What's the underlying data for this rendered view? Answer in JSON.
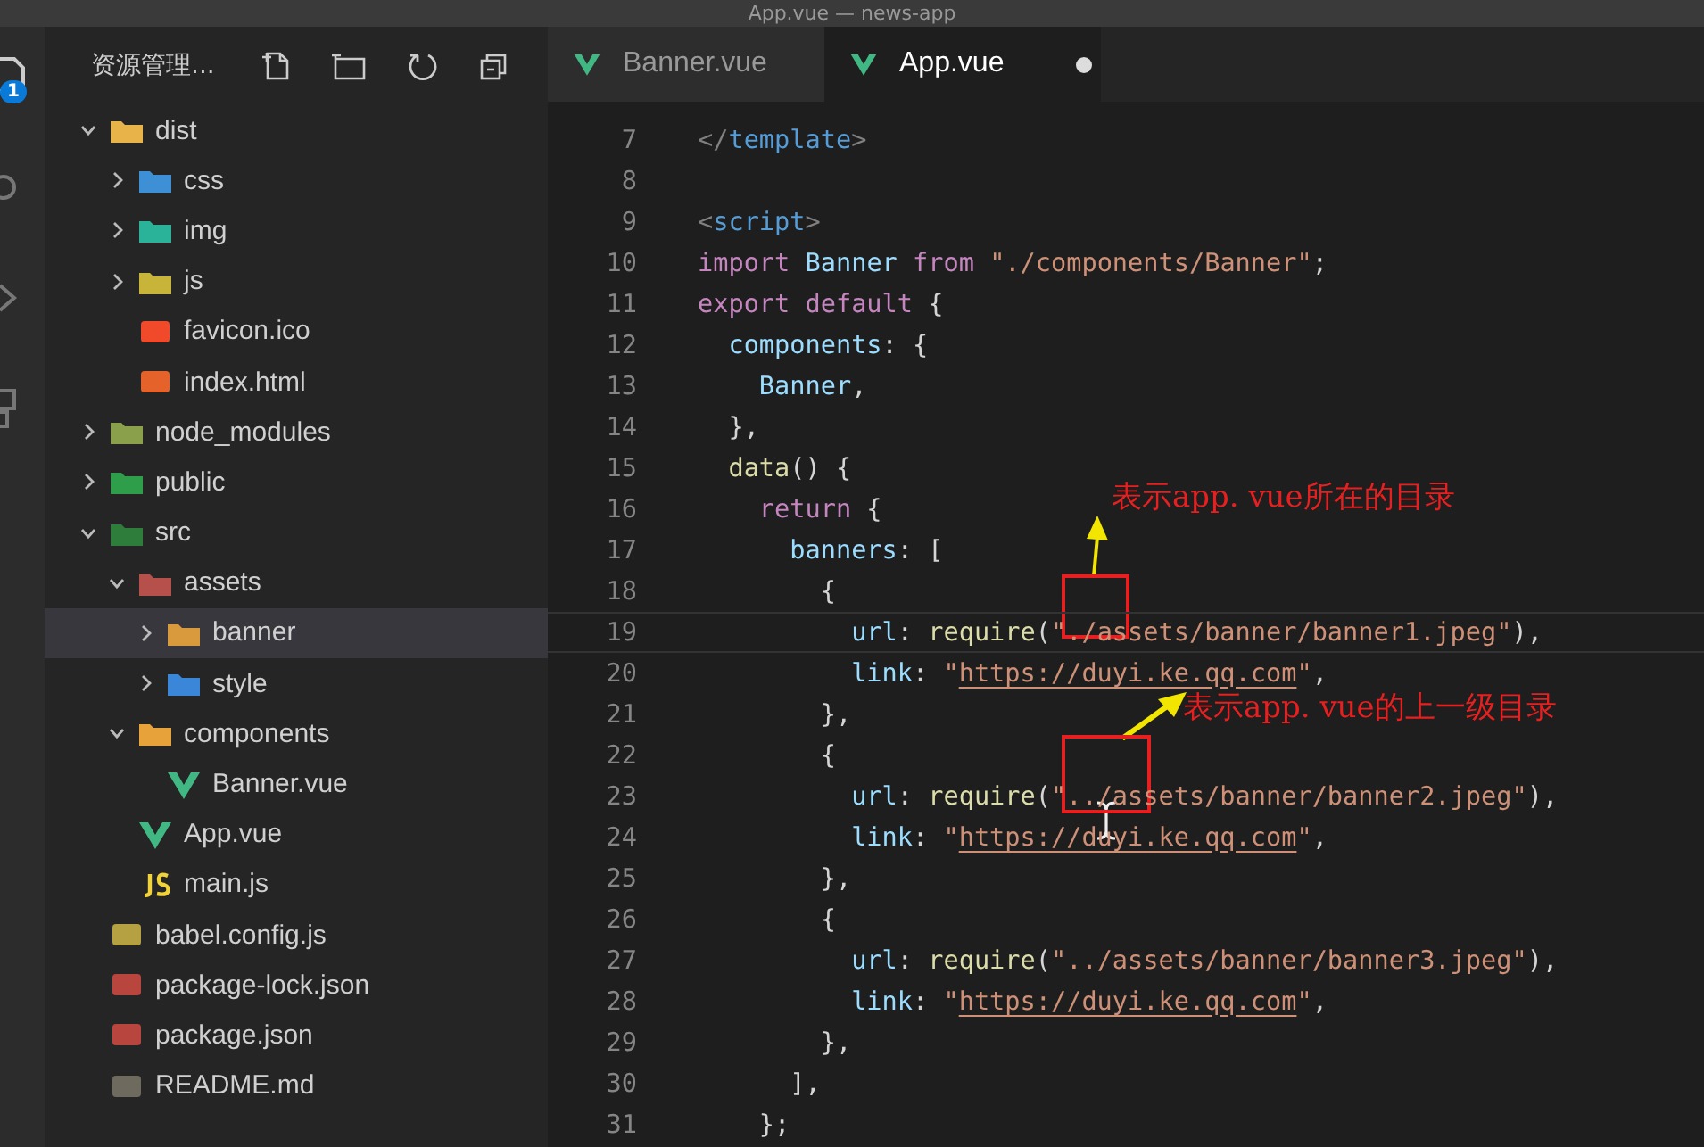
{
  "window": {
    "title": "App.vue — news-app"
  },
  "activity_bar": {
    "badge": "1"
  },
  "sidebar": {
    "title": "资源管理...",
    "tree": [
      {
        "name": "dist",
        "kind": "folder",
        "color": "#e8b44a",
        "expanded": true,
        "selected": false,
        "children": [
          {
            "name": "css",
            "kind": "folder",
            "color": "#3d8fd6",
            "expanded": false,
            "selected": false
          },
          {
            "name": "img",
            "kind": "folder",
            "color": "#2bb39a",
            "expanded": false,
            "selected": false
          },
          {
            "name": "js",
            "kind": "folder",
            "color": "#c9b43a",
            "expanded": false,
            "selected": false
          },
          {
            "name": "favicon.ico",
            "kind": "file",
            "color": "#f04a2a",
            "selected": false
          },
          {
            "name": "index.html",
            "kind": "file",
            "color": "#e5622b",
            "selected": false
          }
        ]
      },
      {
        "name": "node_modules",
        "kind": "folder",
        "color": "#8aa04a",
        "expanded": false,
        "selected": false
      },
      {
        "name": "public",
        "kind": "folder",
        "color": "#2e9e4a",
        "expanded": false,
        "selected": false
      },
      {
        "name": "src",
        "kind": "folder",
        "color": "#2f7d3a",
        "expanded": true,
        "selected": false,
        "children": [
          {
            "name": "assets",
            "kind": "folder",
            "color": "#b5504a",
            "expanded": true,
            "selected": false,
            "children": [
              {
                "name": "banner",
                "kind": "folder",
                "color": "#d89a3c",
                "expanded": false,
                "selected": true
              },
              {
                "name": "style",
                "kind": "folder",
                "color": "#3a86d8",
                "expanded": false,
                "selected": false
              }
            ]
          },
          {
            "name": "components",
            "kind": "folder",
            "color": "#e8a23a",
            "expanded": true,
            "selected": false,
            "children": [
              {
                "name": "Banner.vue",
                "kind": "vue",
                "color": "#41b883",
                "selected": false
              }
            ]
          },
          {
            "name": "App.vue",
            "kind": "vue",
            "color": "#41b883",
            "selected": false
          },
          {
            "name": "main.js",
            "kind": "js",
            "color": "#f1d23a",
            "selected": false
          }
        ]
      },
      {
        "name": "babel.config.js",
        "kind": "file",
        "color": "#b5a042",
        "selected": false
      },
      {
        "name": "package-lock.json",
        "kind": "file",
        "color": "#b8453e",
        "selected": false
      },
      {
        "name": "package.json",
        "kind": "file",
        "color": "#b8453e",
        "selected": false
      },
      {
        "name": "README.md",
        "kind": "file",
        "color": "#6e6a5e",
        "selected": false
      }
    ]
  },
  "tabs": [
    {
      "label": "Banner.vue",
      "selected": false,
      "modified": false
    },
    {
      "label": "App.vue",
      "selected": true,
      "modified": true
    }
  ],
  "editor": {
    "lines": [
      {
        "number": "7",
        "current": false,
        "tokens": [
          {
            "t": "</",
            "kind": "punct"
          },
          {
            "t": "template",
            "kind": "tag"
          },
          {
            "t": ">",
            "kind": "punct"
          }
        ]
      },
      {
        "number": "8",
        "current": false
      },
      {
        "number": "9",
        "current": false,
        "tokens": [
          {
            "t": "<",
            "kind": "punct"
          },
          {
            "t": "script",
            "kind": "tag"
          },
          {
            "t": ">",
            "kind": "punct"
          }
        ]
      },
      {
        "number": "10",
        "current": false,
        "tokens": [
          {
            "t": "import",
            "kind": "keyword"
          },
          {
            "t": " Banner ",
            "kind": "ident"
          },
          {
            "t": "from",
            "kind": "keyword"
          },
          {
            "t": " \"./components/Banner\"",
            "kind": "string"
          },
          {
            "t": ";",
            "kind": "plain"
          }
        ]
      },
      {
        "number": "11",
        "current": false,
        "tokens": [
          {
            "t": "export default",
            "kind": "keyword"
          },
          {
            "t": " {",
            "kind": "plain"
          }
        ]
      },
      {
        "number": "12",
        "current": false,
        "tokens": [
          {
            "t": "  components",
            "kind": "ident"
          },
          {
            "t": ": {",
            "kind": "plain"
          }
        ]
      },
      {
        "number": "13",
        "current": false,
        "tokens": [
          {
            "t": "    Banner",
            "kind": "ident"
          },
          {
            "t": ",",
            "kind": "plain"
          }
        ]
      },
      {
        "number": "14",
        "current": false,
        "tokens": [
          {
            "t": "  },",
            "kind": "plain"
          }
        ]
      },
      {
        "number": "15",
        "current": false,
        "tokens": [
          {
            "t": "  data",
            "kind": "func"
          },
          {
            "t": "() {",
            "kind": "plain"
          }
        ]
      },
      {
        "number": "16",
        "current": false,
        "tokens": [
          {
            "t": "    return",
            "kind": "keyword"
          },
          {
            "t": " {",
            "kind": "plain"
          }
        ]
      },
      {
        "number": "17",
        "current": false,
        "tokens": [
          {
            "t": "      banners",
            "kind": "ident"
          },
          {
            "t": ": [",
            "kind": "plain"
          }
        ]
      },
      {
        "number": "18",
        "current": false,
        "tokens": [
          {
            "t": "        {",
            "kind": "plain"
          }
        ]
      },
      {
        "number": "19",
        "current": true,
        "tokens": [
          {
            "t": "          url",
            "kind": "ident"
          },
          {
            "t": ": ",
            "kind": "plain"
          },
          {
            "t": "require",
            "kind": "func"
          },
          {
            "t": "(",
            "kind": "plain"
          },
          {
            "t": "\"./assets/banner/banner1.jpeg\"",
            "kind": "string"
          },
          {
            "t": "),",
            "kind": "plain"
          }
        ]
      },
      {
        "number": "20",
        "current": false,
        "tokens": [
          {
            "t": "          link",
            "kind": "ident"
          },
          {
            "t": ": ",
            "kind": "plain"
          },
          {
            "t": "\"",
            "kind": "string"
          },
          {
            "t": "https://duyi.ke.qq.com",
            "kind": "link"
          },
          {
            "t": "\"",
            "kind": "string"
          },
          {
            "t": ",",
            "kind": "plain"
          }
        ]
      },
      {
        "number": "21",
        "current": false,
        "tokens": [
          {
            "t": "        },",
            "kind": "plain"
          }
        ]
      },
      {
        "number": "22",
        "current": false,
        "tokens": [
          {
            "t": "        {",
            "kind": "plain"
          }
        ]
      },
      {
        "number": "23",
        "current": false,
        "tokens": [
          {
            "t": "          url",
            "kind": "ident"
          },
          {
            "t": ": ",
            "kind": "plain"
          },
          {
            "t": "require",
            "kind": "func"
          },
          {
            "t": "(",
            "kind": "plain"
          },
          {
            "t": "\"../assets/banner/banner2.jpeg\"",
            "kind": "string"
          },
          {
            "t": "),",
            "kind": "plain"
          }
        ]
      },
      {
        "number": "24",
        "current": false,
        "tokens": [
          {
            "t": "          link",
            "kind": "ident"
          },
          {
            "t": ": ",
            "kind": "plain"
          },
          {
            "t": "\"",
            "kind": "string"
          },
          {
            "t": "https://duyi.ke.qq.com",
            "kind": "link"
          },
          {
            "t": "\"",
            "kind": "string"
          },
          {
            "t": ",",
            "kind": "plain"
          }
        ]
      },
      {
        "number": "25",
        "current": false,
        "tokens": [
          {
            "t": "        },",
            "kind": "plain"
          }
        ]
      },
      {
        "number": "26",
        "current": false,
        "tokens": [
          {
            "t": "        {",
            "kind": "plain"
          }
        ]
      },
      {
        "number": "27",
        "current": false,
        "tokens": [
          {
            "t": "          url",
            "kind": "ident"
          },
          {
            "t": ": ",
            "kind": "plain"
          },
          {
            "t": "require",
            "kind": "func"
          },
          {
            "t": "(",
            "kind": "plain"
          },
          {
            "t": "\"../assets/banner/banner3.jpeg\"",
            "kind": "string"
          },
          {
            "t": "),",
            "kind": "plain"
          }
        ]
      },
      {
        "number": "28",
        "current": false,
        "tokens": [
          {
            "t": "          link",
            "kind": "ident"
          },
          {
            "t": ": ",
            "kind": "plain"
          },
          {
            "t": "\"",
            "kind": "string"
          },
          {
            "t": "https://duyi.ke.qq.com",
            "kind": "link"
          },
          {
            "t": "\"",
            "kind": "string"
          },
          {
            "t": ",",
            "kind": "plain"
          }
        ]
      },
      {
        "number": "29",
        "current": false,
        "tokens": [
          {
            "t": "        },",
            "kind": "plain"
          }
        ]
      },
      {
        "number": "30",
        "current": false,
        "tokens": [
          {
            "t": "      ],",
            "kind": "plain"
          }
        ]
      },
      {
        "number": "31",
        "current": false,
        "tokens": [
          {
            "t": "    };",
            "kind": "plain"
          }
        ]
      }
    ]
  },
  "annotations": [
    {
      "text": "表示app. vue所在的目录"
    },
    {
      "text": "表示app. vue的上一级目录"
    }
  ]
}
